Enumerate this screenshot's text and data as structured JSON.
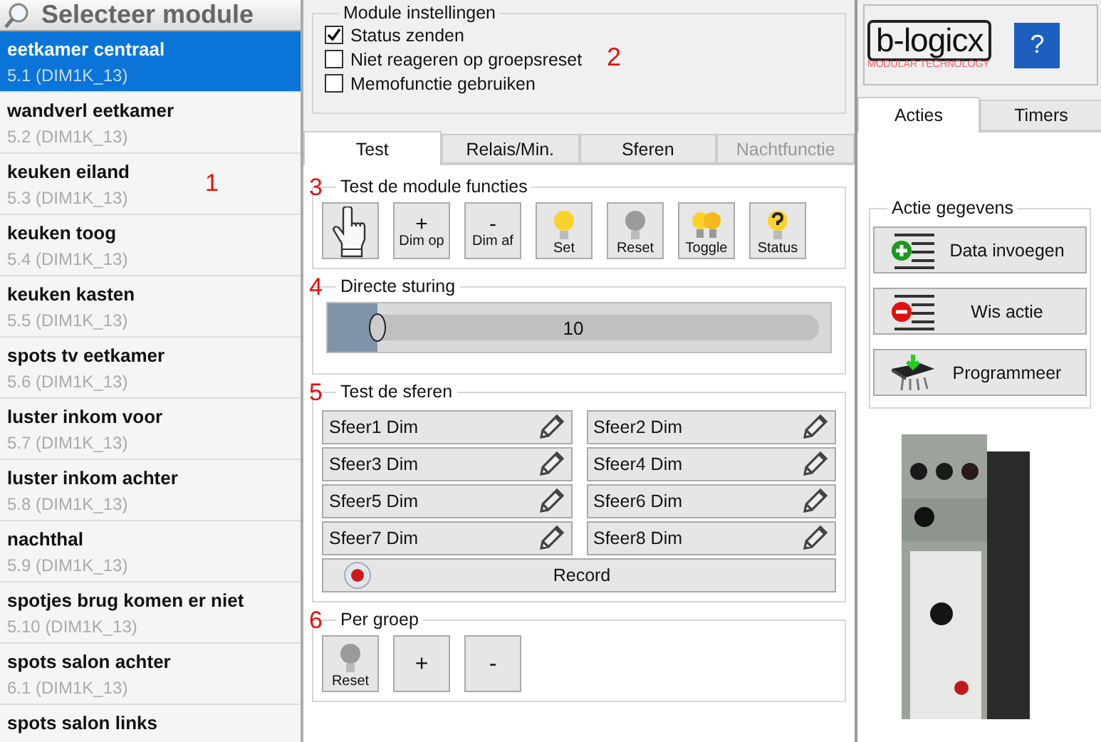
{
  "module_list": {
    "title": "Selecteer module",
    "marker": "1",
    "items": [
      {
        "name": "eetkamer centraal",
        "address": "5.1 (DIM1K_13)",
        "selected": true
      },
      {
        "name": "wandverl eetkamer",
        "address": "5.2 (DIM1K_13)",
        "selected": false
      },
      {
        "name": "keuken eiland",
        "address": "5.3 (DIM1K_13)",
        "selected": false
      },
      {
        "name": "keuken toog",
        "address": "5.4 (DIM1K_13)",
        "selected": false
      },
      {
        "name": "keuken kasten",
        "address": "5.5 (DIM1K_13)",
        "selected": false
      },
      {
        "name": "spots tv eetkamer",
        "address": "5.6 (DIM1K_13)",
        "selected": false
      },
      {
        "name": "luster inkom voor",
        "address": "5.7 (DIM1K_13)",
        "selected": false
      },
      {
        "name": "luster inkom achter",
        "address": "5.8 (DIM1K_13)",
        "selected": false
      },
      {
        "name": "nachthal",
        "address": "5.9 (DIM1K_13)",
        "selected": false
      },
      {
        "name": "spotjes brug komen er niet",
        "address": "5.10 (DIM1K_13)",
        "selected": false
      },
      {
        "name": "spots salon achter",
        "address": "6.1 (DIM1K_13)",
        "selected": false
      },
      {
        "name": "spots salon links",
        "selected": false
      }
    ]
  },
  "module_settings": {
    "title": "Module instellingen",
    "marker": "2",
    "options": [
      {
        "label": "Status zenden",
        "checked": true
      },
      {
        "label": "Niet reageren op groepsreset",
        "checked": false
      },
      {
        "label": "Memofunctie gebruiken",
        "checked": false
      }
    ]
  },
  "tabs": [
    {
      "label": "Test",
      "selected": true,
      "disabled": false
    },
    {
      "label": "Relais/Min.",
      "selected": false,
      "disabled": false
    },
    {
      "label": "Sferen",
      "selected": false,
      "disabled": false
    },
    {
      "label": "Nachtfunctie",
      "selected": false,
      "disabled": true
    }
  ],
  "test_functions": {
    "title": "Test de module functies",
    "marker": "3",
    "buttons": [
      {
        "kind": "hand"
      },
      {
        "kind": "symbol",
        "symbol": "+",
        "label": "Dim op"
      },
      {
        "kind": "symbol",
        "symbol": "-",
        "label": "Dim af"
      },
      {
        "kind": "bulb-on",
        "label": "Set"
      },
      {
        "kind": "bulb-off",
        "label": "Reset"
      },
      {
        "kind": "toggle",
        "label": "Toggle"
      },
      {
        "kind": "status",
        "label": "Status"
      }
    ]
  },
  "direct_control": {
    "title": "Directe sturing",
    "marker": "4",
    "level": 0.1,
    "reading": "10"
  },
  "scenes": {
    "title": "Test de sferen",
    "marker": "5",
    "buttons": [
      "Sfeer1 Dim",
      "Sfeer2 Dim",
      "Sfeer3 Dim",
      "Sfeer4 Dim",
      "Sfeer5 Dim",
      "Sfeer6 Dim",
      "Sfeer7 Dim",
      "Sfeer8 Dim"
    ],
    "record": "Record"
  },
  "group": {
    "title": "Per groep",
    "marker": "6",
    "buttons": [
      {
        "kind": "bulb-off",
        "label": "Reset"
      },
      {
        "kind": "symbol",
        "symbol": "+"
      },
      {
        "kind": "symbol",
        "symbol": "-"
      }
    ]
  },
  "logo": {
    "name": "b-logicx",
    "tagline": "MODULAR TECHNOLOGY"
  },
  "help_button": "?",
  "action_tabs": [
    {
      "label": "Acties",
      "selected": true
    },
    {
      "label": "Timers",
      "selected": false
    }
  ],
  "action_data": {
    "title": "Actie gegevens",
    "buttons": [
      {
        "kind": "add",
        "label": "Data invoegen"
      },
      {
        "kind": "remove",
        "label": "Wis actie"
      },
      {
        "kind": "chip",
        "label": "Programmeer"
      }
    ]
  }
}
